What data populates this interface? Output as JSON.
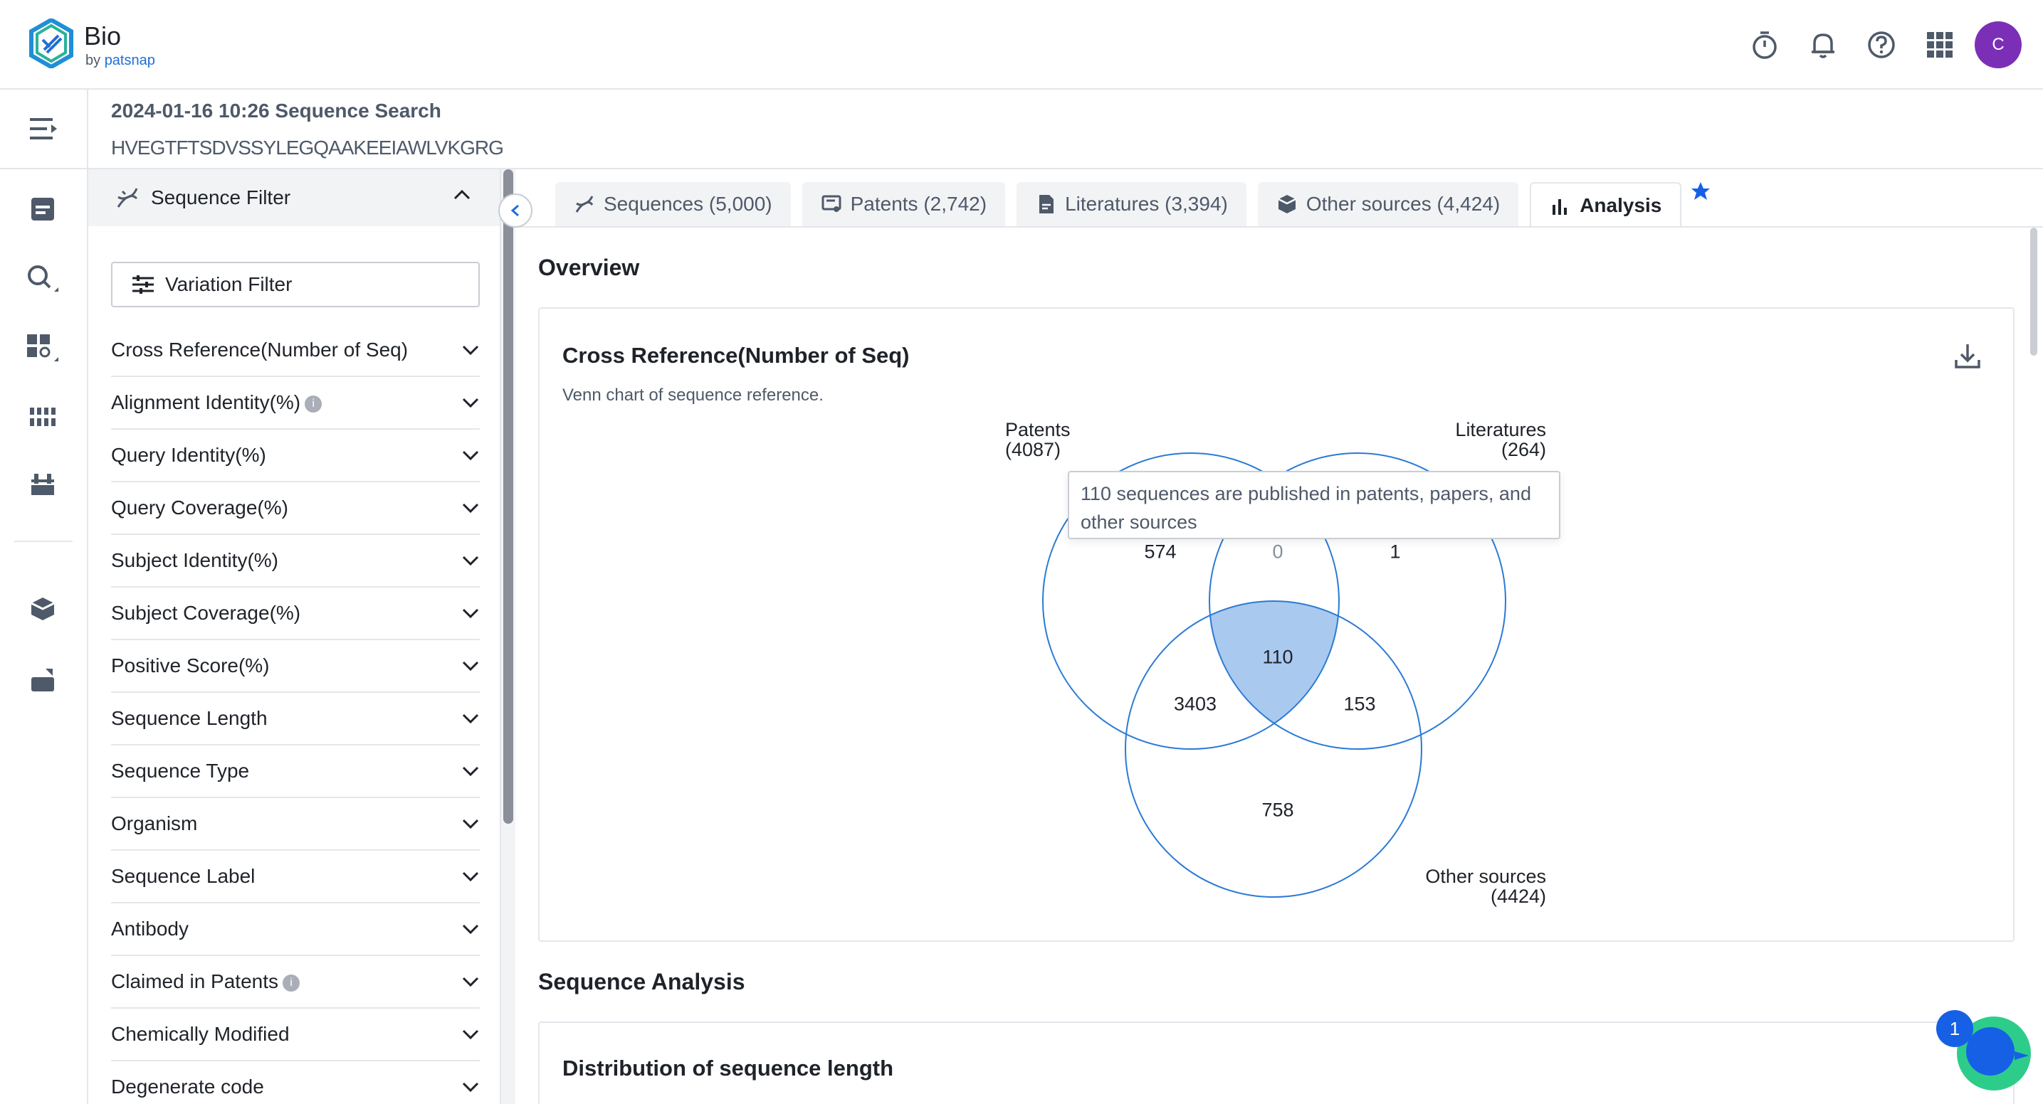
{
  "app": {
    "name": "Bio",
    "by": "by",
    "brand": "patsnap",
    "avatar_initial": "C",
    "brand_color": "#1f6fd6",
    "avatar_color": "#7b2fb6"
  },
  "header_icons": [
    "timer-icon",
    "bell-icon",
    "help-icon",
    "apps-grid-icon"
  ],
  "search": {
    "title": "2024-01-16 10:26 Sequence Search",
    "sequence": "HVEGTFTSDVSSYLEGQAAKEEIAWLVKGRG"
  },
  "filter": {
    "header": "Sequence Filter",
    "variation_button": "Variation Filter",
    "items": [
      {
        "label": "Cross Reference(Number of Seq)",
        "info": false
      },
      {
        "label": "Alignment Identity(%)",
        "info": true
      },
      {
        "label": "Query Identity(%)",
        "info": false
      },
      {
        "label": "Query Coverage(%)",
        "info": false
      },
      {
        "label": "Subject Identity(%)",
        "info": false
      },
      {
        "label": "Subject Coverage(%)",
        "info": false
      },
      {
        "label": "Positive Score(%)",
        "info": false
      },
      {
        "label": "Sequence Length",
        "info": false
      },
      {
        "label": "Sequence Type",
        "info": false
      },
      {
        "label": "Organism",
        "info": false
      },
      {
        "label": "Sequence Label",
        "info": false
      },
      {
        "label": "Antibody",
        "info": false
      },
      {
        "label": "Claimed in Patents",
        "info": true
      },
      {
        "label": "Chemically Modified",
        "info": false
      },
      {
        "label": "Degenerate code",
        "info": false
      }
    ]
  },
  "tabs": [
    {
      "label": "Sequences (5,000)",
      "icon": "dna-icon",
      "active": false
    },
    {
      "label": "Patents (2,742)",
      "icon": "patent-icon",
      "active": false
    },
    {
      "label": "Literatures (3,394)",
      "icon": "document-icon",
      "active": false
    },
    {
      "label": "Other sources (4,424)",
      "icon": "cube-icon",
      "active": false
    },
    {
      "label": "Analysis",
      "icon": "bar-chart-icon",
      "active": true
    }
  ],
  "main": {
    "overview_title": "Overview",
    "cross_ref": {
      "title": "Cross Reference(Number of Seq)",
      "subtitle": "Venn chart of sequence reference.",
      "sets": {
        "patents": {
          "name": "Patents",
          "count": "(4087)"
        },
        "literatures": {
          "name": "Literatures",
          "count": "(264)"
        },
        "other": {
          "name": "Other sources",
          "count": "(4424)"
        }
      },
      "regions": {
        "patents_only": "574",
        "patents_literatures": "0",
        "literatures_only": "1",
        "all_three": "110",
        "patents_other": "3403",
        "literatures_other": "153",
        "other_only": "758"
      },
      "tooltip": "110 sequences are published in patents, papers, and other sources",
      "highlight_color": "#a9c9ef",
      "circle_color": "#2a7ad6"
    },
    "sequence_analysis_title": "Sequence Analysis",
    "distribution_title": "Distribution of sequence length"
  },
  "assistant": {
    "badge": "1"
  }
}
